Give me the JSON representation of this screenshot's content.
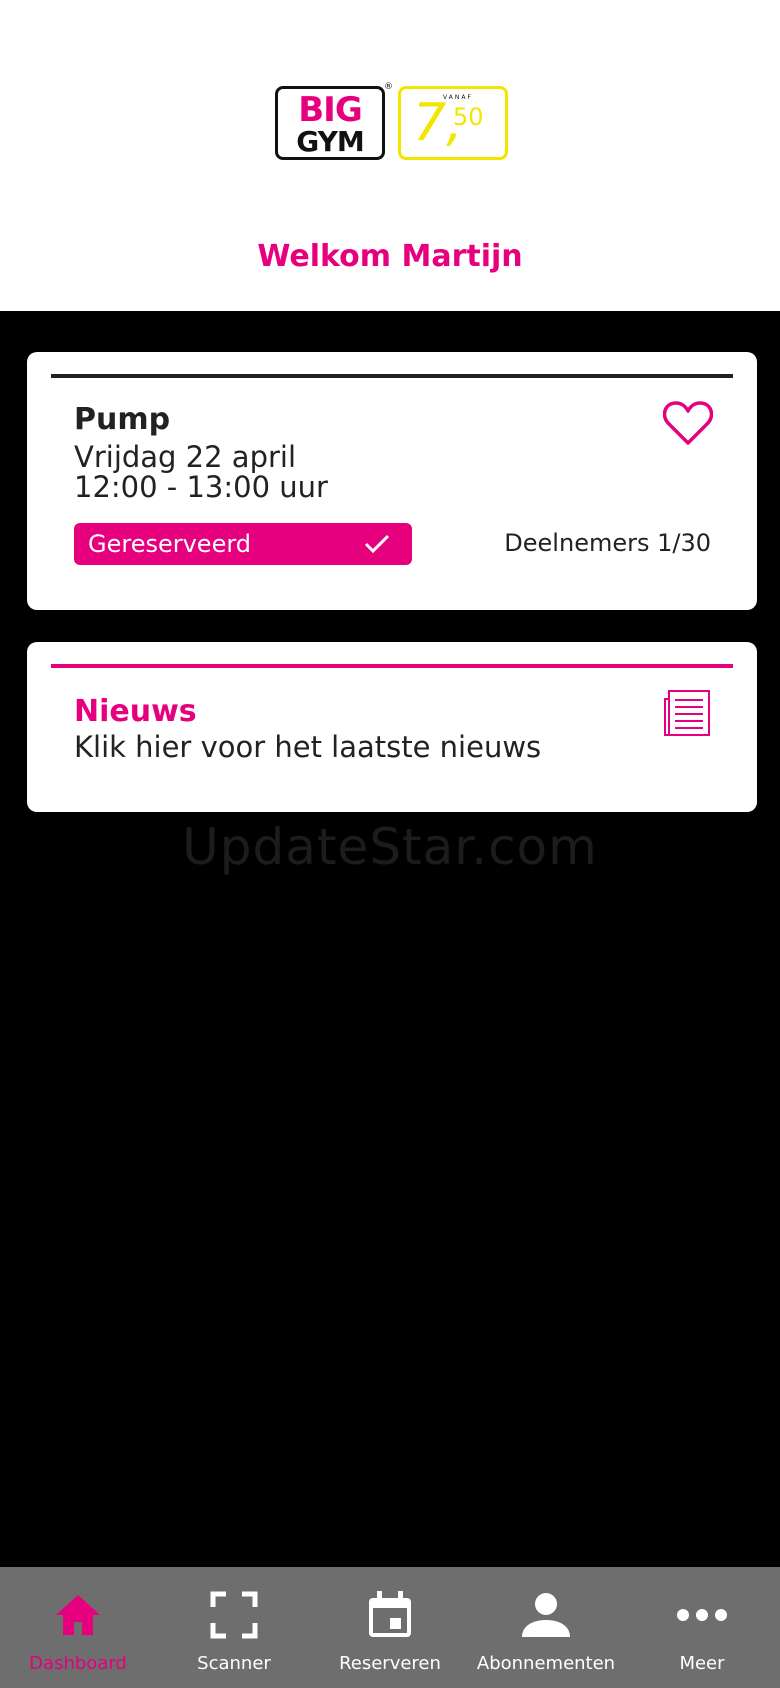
{
  "colors": {
    "brand_pink": "#e6007e",
    "brand_yellow": "#f2e600",
    "nav_background": "#6e6e6e",
    "page_background": "#000000"
  },
  "header": {
    "logo": {
      "big": "BIG",
      "gym": "GYM",
      "registered": "®",
      "vanaf": "VANAF",
      "price_main": "7,",
      "price_cents": "50"
    },
    "welcome": "Welkom Martijn"
  },
  "class_card": {
    "title": "Pump",
    "date": "Vrijdag 22 april",
    "time": "12:00 - 13:00 uur",
    "status_label": "Gereserveerd",
    "participants": "Deelnemers 1/30",
    "favorite_icon": "heart-outline-icon",
    "status_icon": "checkmark-icon"
  },
  "news_card": {
    "title": "Nieuws",
    "text": "Klik hier voor het laatste nieuws",
    "icon": "newspaper-icon"
  },
  "watermark": "UpdateStar.com",
  "bottom_nav": {
    "active": "Dashboard",
    "items": [
      {
        "label": "Dashboard",
        "icon": "home-icon"
      },
      {
        "label": "Scanner",
        "icon": "scan-frame-icon"
      },
      {
        "label": "Reserveren",
        "icon": "calendar-icon"
      },
      {
        "label": "Abonnementen",
        "icon": "person-icon"
      },
      {
        "label": "Meer",
        "icon": "more-dots-icon"
      }
    ]
  }
}
